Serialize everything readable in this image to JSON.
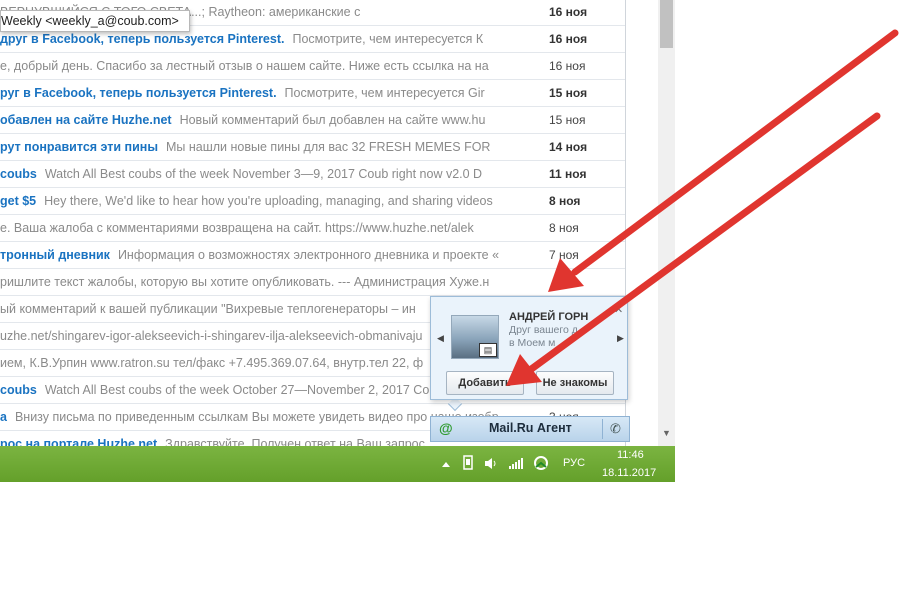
{
  "tooltip": {
    "text": "Weekly <weekly_a@coub.com>"
  },
  "mail_rows": [
    {
      "sender": "",
      "subject": "ВЕРНУВШИЙСЯ С ТОГО СВЕТА...; Raytheon: американские с",
      "date": "16 ноя",
      "unread": true
    },
    {
      "sender": "друг в Facebook, теперь пользуется Pinterest.",
      "subject": "Посмотрите, чем интересуется К",
      "date": "16 ноя",
      "unread": true
    },
    {
      "sender": "",
      "subject": "е, добрый день. Спасибо за лестный отзыв о нашем сайте. Ниже есть ссылка на на",
      "date": "16 ноя",
      "unread": false
    },
    {
      "sender": "руг в Facebook, теперь пользуется Pinterest.",
      "subject": "Посмотрите, чем интересуется Gir",
      "date": "15 ноя",
      "unread": true
    },
    {
      "sender": "обавлен на сайте Huzhe.net",
      "subject": "Новый комментарий был добавлен на сайте www.hu",
      "date": "15 ноя",
      "unread": false
    },
    {
      "sender": "рут понравится эти пины",
      "subject": "Мы нашли новые пины для вас 32 FRESH MEMES FOR",
      "date": "14 ноя",
      "unread": true
    },
    {
      "sender": "coubs",
      "subject": "Watch All Best coubs of the week November 3—9, 2017 Coub right now v2.0 D",
      "date": "11 ноя",
      "unread": true
    },
    {
      "sender": "get $5",
      "subject": "Hey there, We'd like to hear how you're uploading, managing, and sharing videos",
      "date": "8 ноя",
      "unread": true
    },
    {
      "sender": "",
      "subject": "е. Ваша жалоба с комментариями возвращена на сайт. https://www.huzhe.net/alek",
      "date": "8 ноя",
      "unread": false
    },
    {
      "sender": "тронный дневник",
      "subject": "Информация о возможностях электронного дневника и проекте «",
      "date": "7 ноя",
      "unread": false
    },
    {
      "sender": "",
      "subject": "ришлите текст жалобы, которую вы хотите опубликовать. --- Администрация Хуже.н",
      "date": "",
      "unread": false
    },
    {
      "sender": "",
      "subject": "ый комментарий к вашей публикации \"Вихревые теплогенераторы – ин",
      "date": "",
      "unread": false
    },
    {
      "sender": "",
      "subject": "uzhe.net/shingarev-igor-alekseevich-i-shingarev-ilja-alekseevich-obmanivaju",
      "date": "",
      "unread": false
    },
    {
      "sender": "",
      "subject": "ием, К.В.Урпин www.ratron.su тел/факс +7.495.369.07.64, внутр.тел 22, ф",
      "date": "",
      "unread": false
    },
    {
      "sender": "coubs",
      "subject": "Watch All Best coubs of the week October 27—November 2, 2017 Co",
      "date": "",
      "unread": true
    },
    {
      "sender": "а",
      "subject": "Внизу письма по приведенным ссылкам Вы можете увидеть видео про наше изобр",
      "date": "3 ноя",
      "unread": false
    },
    {
      "sender": "рос на портале Huzhe.net",
      "subject": "Здравствуйте. Получен ответ на Ваш запрос",
      "date": "",
      "unread": false
    }
  ],
  "popup": {
    "name": "АНДРЕЙ ГОРН",
    "subtitle_1": "Друг вашего д    а",
    "subtitle_2": "в Моем м",
    "add_label": "Добавить",
    "unknown_label": "Не знакомы"
  },
  "agent": {
    "title": "Mail.Ru Агент"
  },
  "tray": {
    "lang": "РУС",
    "time": "11:46",
    "date": "18.11.2017"
  },
  "colors": {
    "arrow": "#e0352f",
    "taskbar": "#6ea935",
    "link_blue": "#1a73c1"
  }
}
